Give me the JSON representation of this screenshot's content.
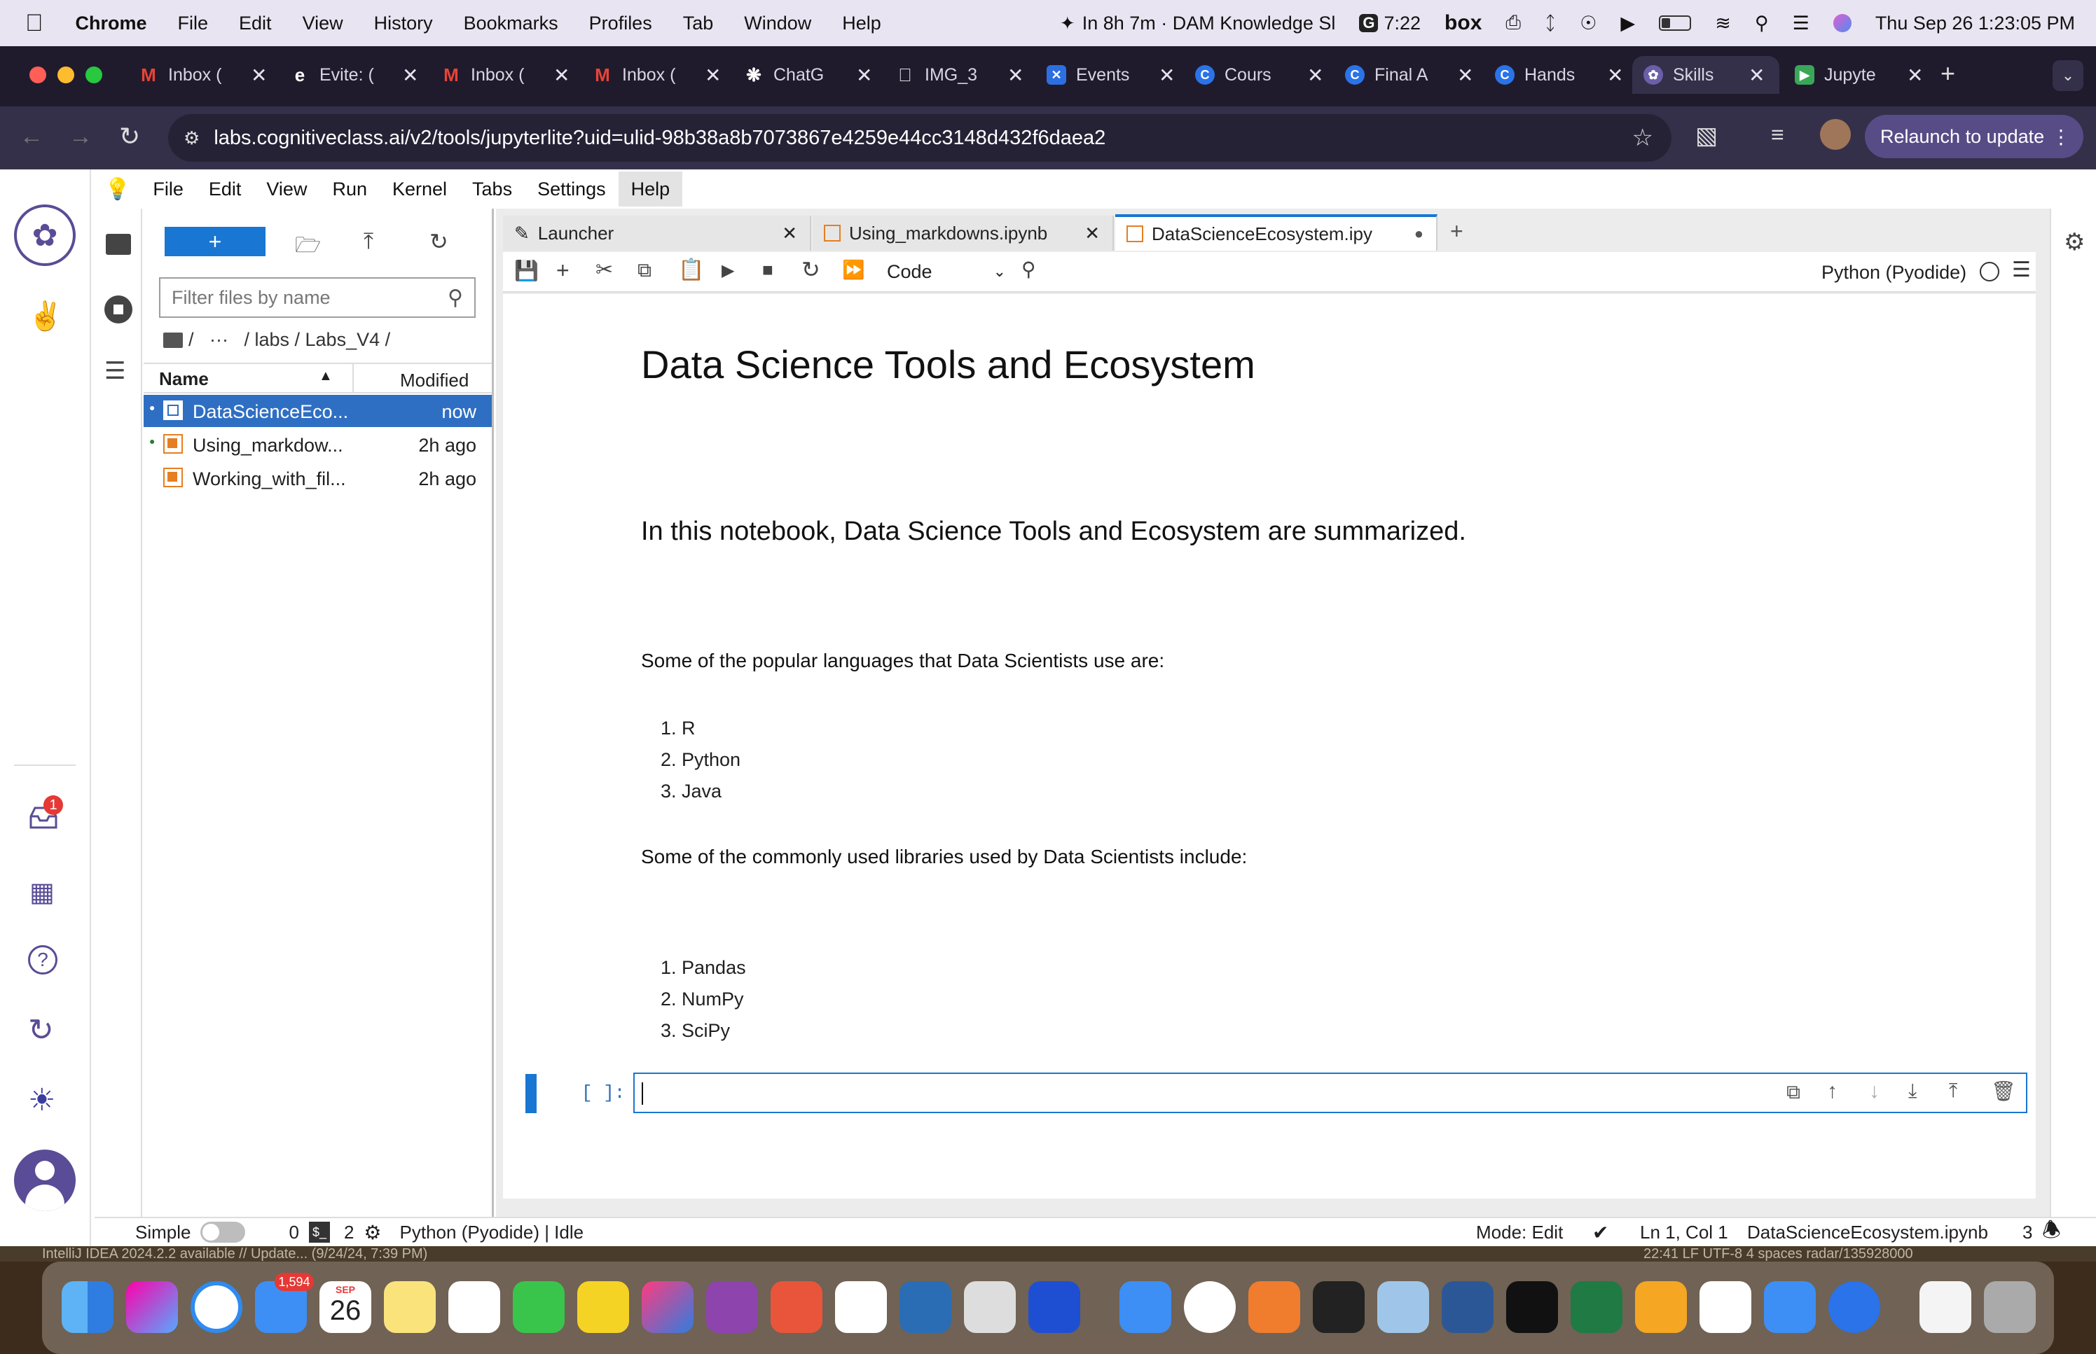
{
  "mac_menubar": {
    "app_name": "Chrome",
    "items": [
      "File",
      "Edit",
      "View",
      "History",
      "Bookmarks",
      "Profiles",
      "Tab",
      "Window",
      "Help"
    ],
    "calendar_event": "In 8h 7m · DAM Knowledge Sl",
    "timer": "7:22",
    "box_label": "box",
    "datetime": "Thu Sep 26  1:23:05 PM"
  },
  "browser": {
    "tabs": [
      {
        "title": "Inbox (",
        "icon": "gmail-icon"
      },
      {
        "title": "Evite: (",
        "icon": "evite-icon"
      },
      {
        "title": "Inbox (",
        "icon": "gmail-icon"
      },
      {
        "title": "Inbox (",
        "icon": "gmail-icon"
      },
      {
        "title": "ChatG",
        "icon": "chatgpt-icon"
      },
      {
        "title": "IMG_3",
        "icon": "apple-icon"
      },
      {
        "title": "Events",
        "icon": "x-icon"
      },
      {
        "title": "Cours",
        "icon": "coursera-icon"
      },
      {
        "title": "Final A",
        "icon": "coursera-icon"
      },
      {
        "title": "Hands",
        "icon": "coursera-icon"
      },
      {
        "title": "Skills",
        "icon": "skills-icon"
      },
      {
        "title": "Jupyte",
        "icon": "jupyter-icon"
      }
    ],
    "active_tab_index": 10,
    "url": "labs.cognitiveclass.ai/v2/tools/jupyterlite?uid=ulid-98b38a8b7073867e4259e44cc3148d432f6daea2",
    "relaunch_label": "Relaunch to update"
  },
  "jupyter": {
    "menu": [
      "File",
      "Edit",
      "View",
      "Run",
      "Kernel",
      "Tabs",
      "Settings",
      "Help"
    ],
    "highlighted_menu": "Help",
    "filebrowser": {
      "new_label": "+",
      "filter_placeholder": "Filter files by name",
      "breadcrumb": "/   ···   / labs / Labs_V4 /",
      "col_name": "Name",
      "col_modified": "Modified",
      "files": [
        {
          "name": "DataScienceEco...",
          "modified": "now",
          "selected": true
        },
        {
          "name": "Using_markdow...",
          "modified": "2h ago",
          "selected": false
        },
        {
          "name": "Working_with_fil...",
          "modified": "2h ago",
          "selected": false
        }
      ]
    },
    "tabs": [
      {
        "title": "Launcher"
      },
      {
        "title": "Using_markdowns.ipynb"
      },
      {
        "title": "DataScienceEcosystem.ipy"
      }
    ],
    "cell_type": "Code",
    "kernel": "Python (Pyodide)",
    "notebook": {
      "title": "Data Science Tools and Ecosystem",
      "intro": "In this notebook, Data Science Tools and Ecosystem are summarized.",
      "languages_heading": "Some of the popular languages that Data Scientists use are:",
      "languages": [
        "1. R",
        "2. Python",
        "3. Java"
      ],
      "libraries_heading": "Some of the commonly used libraries used by Data Scientists include:",
      "libraries": [
        "1. Pandas",
        "2. NumPy",
        "3. SciPy"
      ],
      "prompt": "[ ]:"
    },
    "status": {
      "mode_label": "Simple",
      "count_a": "0",
      "count_b": "2",
      "kernel_status": "Python (Pyodide) | Idle",
      "edit_mode": "Mode: Edit",
      "cursor": "Ln 1, Col 1",
      "file": "DataScienceEcosystem.ipynb",
      "notifications": "3"
    },
    "inbox_badge": "1"
  },
  "underlay_text": "IntelliJ IDEA 2024.2.2 available // Update... (9/24/24, 7:39 PM)",
  "underlay_right": "22:41   LF   UTF-8   4 spaces   radar/135928000",
  "dock": {
    "mail_badge": "1,594",
    "calendar_month": "SEP",
    "calendar_day": "26"
  }
}
